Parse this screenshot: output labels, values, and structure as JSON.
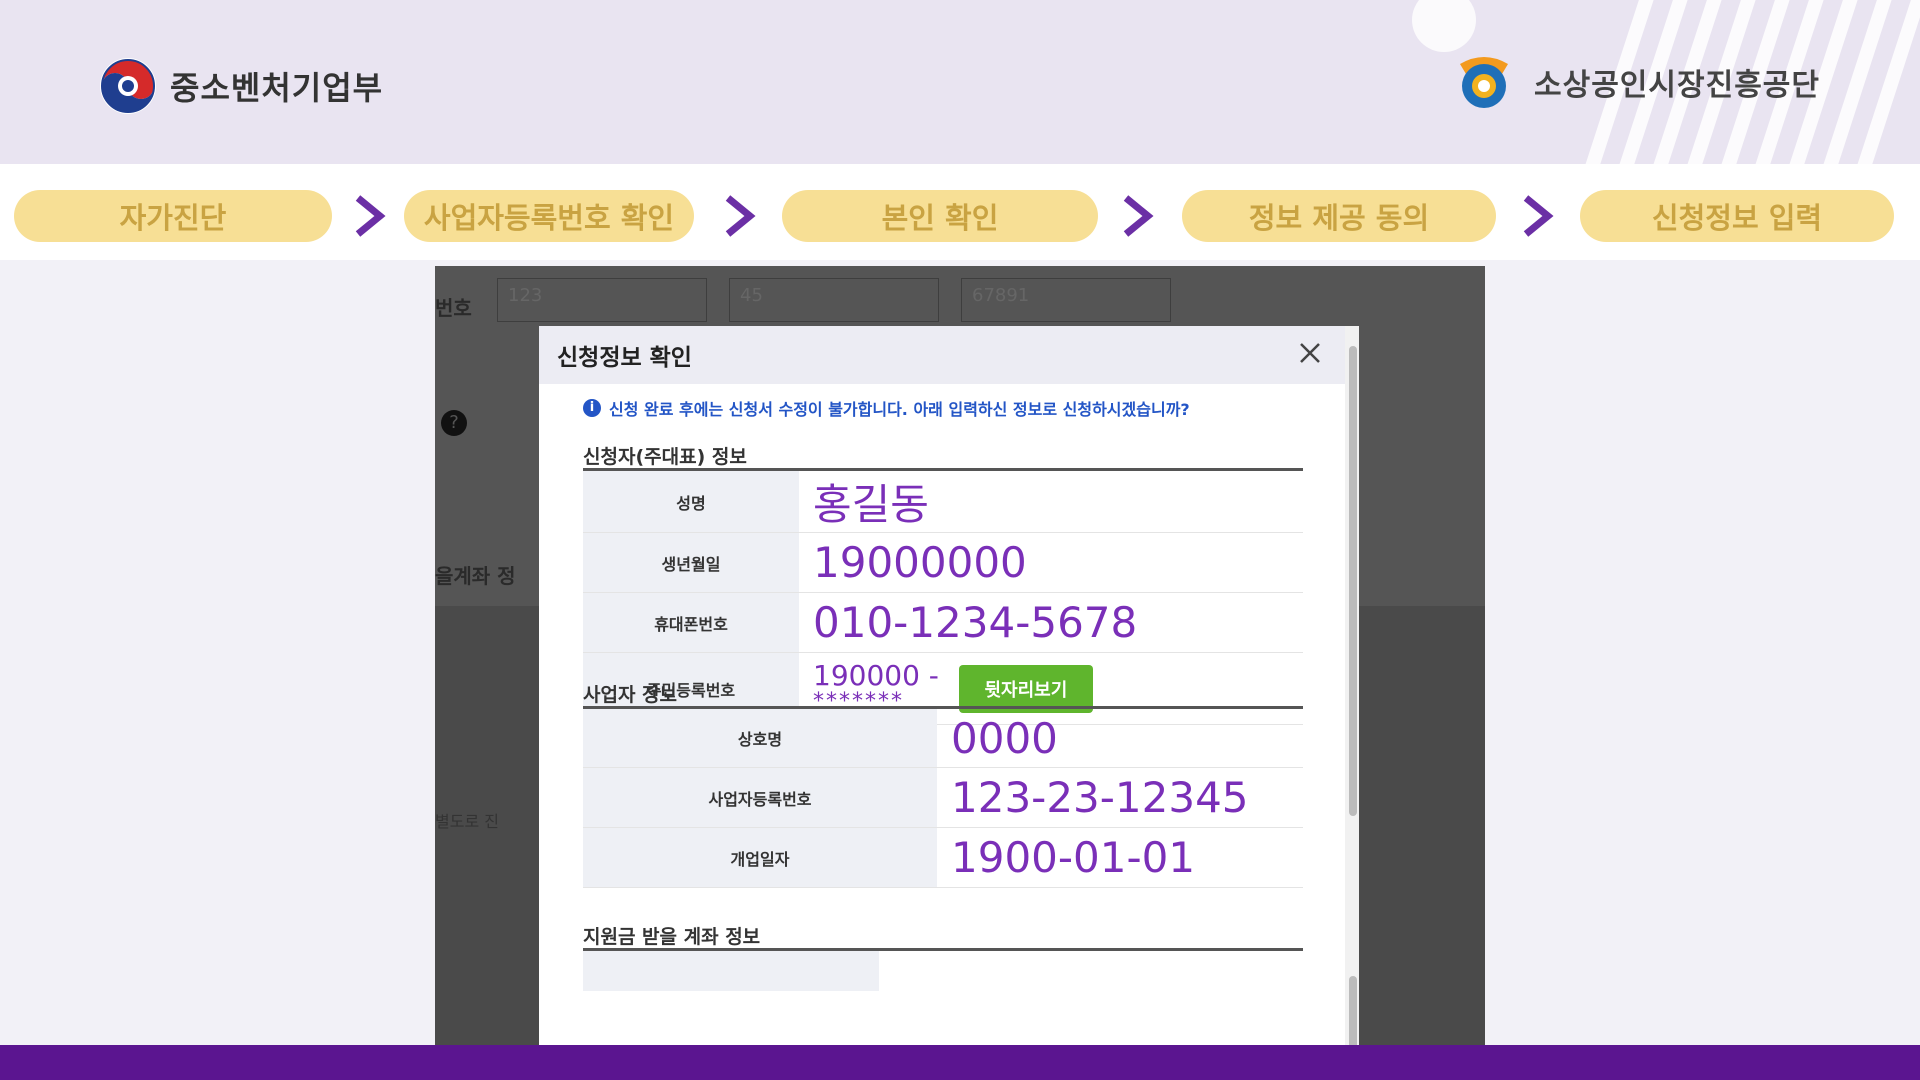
{
  "header": {
    "ministry_name": "중소벤처기업부",
    "agency_name": "소상공인시장진흥공단"
  },
  "steps": [
    {
      "label": "자가진단"
    },
    {
      "label": "사업자등록번호 확인"
    },
    {
      "label": "본인 확인"
    },
    {
      "label": "정보 제공 동의"
    },
    {
      "label": "신청정보 입력"
    }
  ],
  "background_form": {
    "label_number": "번호",
    "input_1": "123",
    "input_2": "45",
    "input_3": "67891",
    "section_account": "을계좌 정",
    "note": "별도로 진"
  },
  "modal": {
    "title": "신청정보 확인",
    "notice": "신청 완료 후에는 신청서 수정이 불가합니다. 아래 입력하신 정보로 신청하시겠습니까?",
    "applicant_section": "신청자(주대표) 정보",
    "applicant": {
      "name_label": "성명",
      "name_value": "홍길동",
      "birth_label": "생년월일",
      "birth_value": "19000000",
      "phone_label": "휴대폰번호",
      "phone_value": "010-1234-5678",
      "rrn_label": "주민등록번호",
      "rrn_front": "190000 -",
      "rrn_back": "*******",
      "rrn_button": "뒷자리보기"
    },
    "business_section": "사업자 정보",
    "business": {
      "trade_name_label": "상호명",
      "trade_name_value": "0000",
      "reg_no_label": "사업자등록번호",
      "reg_no_value": "123-23-12345",
      "open_date_label": "개업일자",
      "open_date_value": "1900-01-01"
    },
    "account_section": "지원금 받을 계좌 정보"
  },
  "colors": {
    "step_fill": "#f7df95",
    "step_text": "#c9a342",
    "chevron": "#6b2fa5",
    "value_purple": "#7a2fb8",
    "button_green": "#5fb52d",
    "bottom_bar": "#5b1590"
  }
}
